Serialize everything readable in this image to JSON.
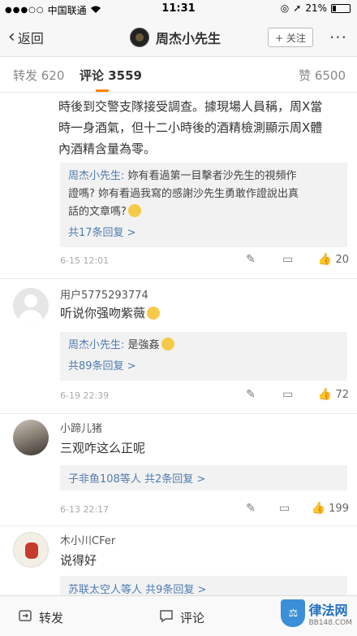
{
  "status_bar": {
    "carrier": "中国联通",
    "time": "11:31",
    "battery": "21%",
    "battery_level": 0.21
  },
  "nav": {
    "back_label": "返回",
    "title": "周杰小先生",
    "follow_label": "+ 关注",
    "more": "···"
  },
  "tabs": {
    "repost": "转发 620",
    "comment": "评论 3559",
    "like": "赞 6500"
  },
  "post": {
    "lines": [
      "時後到交警支隊接受調查。據現場人員稱，周X當",
      "時一身酒氣，但十二小時後的酒精檢測顯示周X體",
      "內酒精含量為零。"
    ],
    "reply_name": "周杰小先生:",
    "reply_lines": [
      " 妳有看過第一目擊者沙先生的視頻作",
      "證嗎? 妳有看過我寫的感謝沙先生勇敢作證說出真",
      "話的文章嗎?"
    ],
    "reply_more": "共17条回复 >",
    "time": "6-15 12:01",
    "likes": "20"
  },
  "comments": [
    {
      "user": "用户5775293774",
      "text": "听说你强吻紫薇",
      "reply_name": "周杰小先生:",
      "reply_text": " 是強姦",
      "reply_more": "共89条回复 >",
      "time": "6-19 22:39",
      "likes": "72"
    },
    {
      "user": "小蹄儿猪",
      "text": "三观咋这么正呢",
      "reply_summary": "子非鱼108等人  共2条回复 >",
      "time": "6-13 22:17",
      "likes": "199"
    },
    {
      "user": "木小川CFer",
      "text": "说得好",
      "reply_summary": "苏联太空人等人  共9条回复 >"
    }
  ],
  "bottom_bar": {
    "repost": "转发",
    "comment": "评论"
  },
  "watermark": {
    "brand": "律法网",
    "site": "BB148.COM"
  }
}
